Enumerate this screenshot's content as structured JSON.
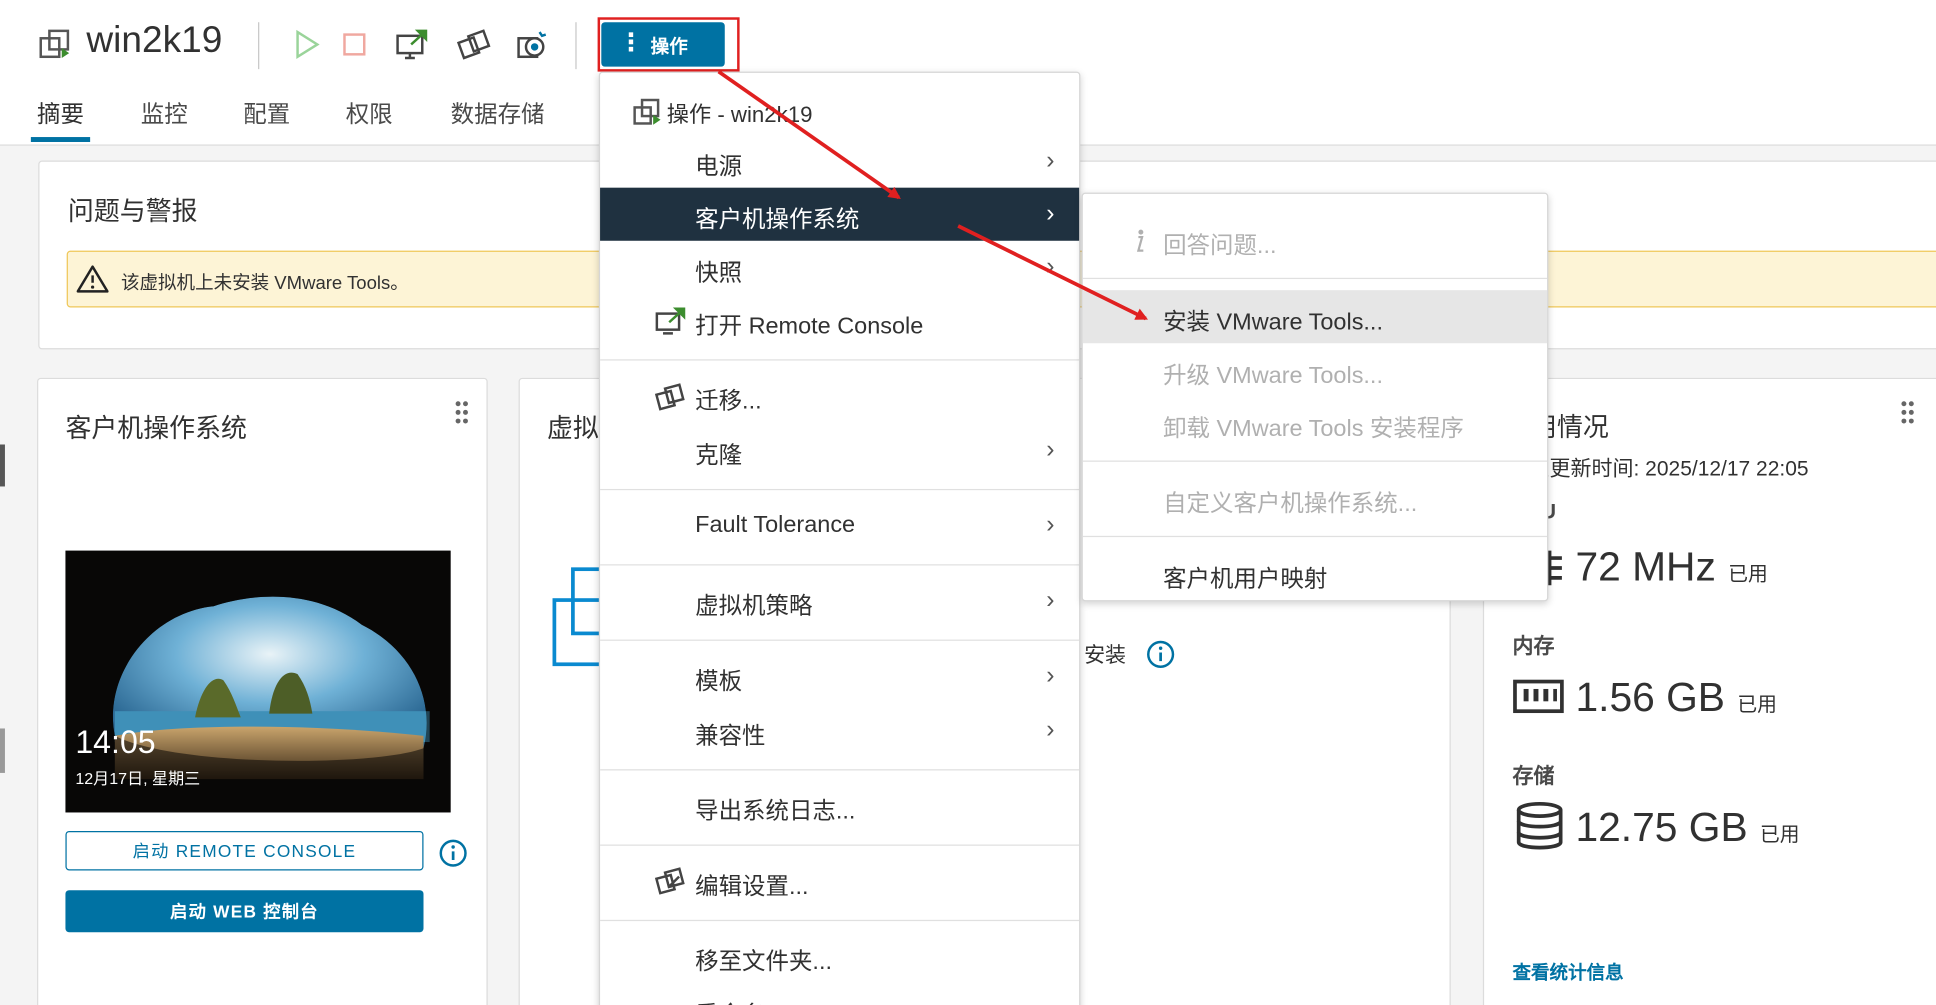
{
  "vm": {
    "title": "win2k19"
  },
  "toolbar": {
    "actions_label": "操作"
  },
  "tabs": [
    {
      "label": "摘要"
    },
    {
      "label": "监控"
    },
    {
      "label": "配置"
    },
    {
      "label": "权限"
    },
    {
      "label": "数据存储"
    }
  ],
  "issues": {
    "title": "问题与警报",
    "alert_text": "该虚拟机上未安装 VMware Tools。"
  },
  "guest_os_card": {
    "title": "客户机操作系统",
    "screen_time": "14:05",
    "screen_date": "12月17日, 星期三",
    "remote_console_button": "启动 REMOTE CONSOLE",
    "web_console_button": "启动 WEB 控制台"
  },
  "vm_details_card": {
    "title_partial": "虚拟",
    "tools_status_partial": "安装"
  },
  "usage_card": {
    "title_partial": "用情况",
    "updated_partial": "次更新时间: 2025/12/17 22:05",
    "cpu_label_partial": "U",
    "cpu_value": "72 MHz",
    "memory_label": "内存",
    "memory_value": "1.56 GB",
    "storage_label": "存储",
    "storage_value": "12.75 GB",
    "used_unit": "已用",
    "stats_link": "查看统计信息"
  },
  "actions_menu": {
    "header": "操作 - win2k19",
    "items": [
      {
        "label": "电源"
      },
      {
        "label": "客户机操作系统"
      },
      {
        "label": "快照"
      },
      {
        "label": "打开 Remote Console"
      },
      {
        "label": "迁移..."
      },
      {
        "label": "克隆"
      },
      {
        "label": "Fault Tolerance"
      },
      {
        "label": "虚拟机策略"
      },
      {
        "label": "模板"
      },
      {
        "label": "兼容性"
      },
      {
        "label": "导出系统日志..."
      },
      {
        "label": "编辑设置..."
      },
      {
        "label": "移至文件夹..."
      },
      {
        "label": "重命名..."
      }
    ]
  },
  "guest_submenu": {
    "items": [
      {
        "label": "回答问题..."
      },
      {
        "label": "安装 VMware Tools..."
      },
      {
        "label": "升级 VMware Tools..."
      },
      {
        "label": "卸载 VMware Tools 安装程序"
      },
      {
        "label": "自定义客户机操作系统..."
      },
      {
        "label": "客户机用户映射"
      }
    ]
  },
  "colors": {
    "accent": "#0072a3",
    "menu_highlight": "#1f3140",
    "annotation": "#e02020",
    "alert_bg": "#fdf4d6"
  }
}
